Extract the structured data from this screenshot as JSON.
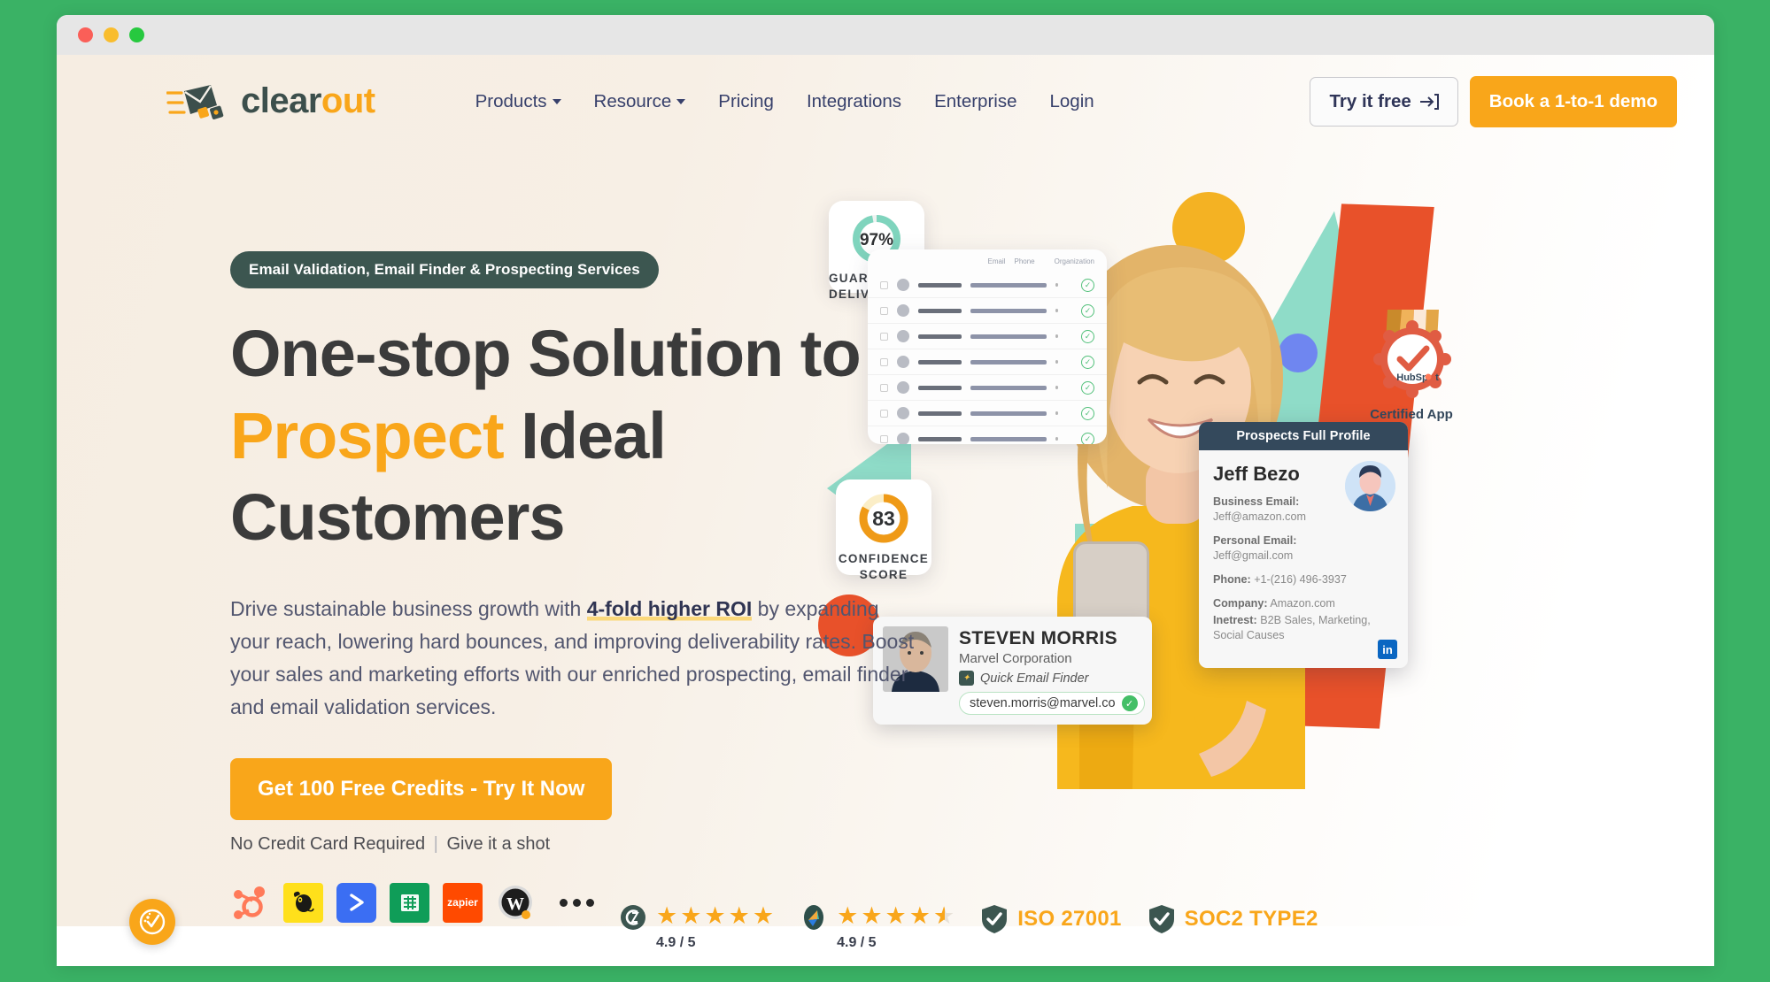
{
  "browser": {
    "dots": [
      "close",
      "minimize",
      "maximize"
    ]
  },
  "header": {
    "logo": {
      "part1": "clear",
      "part2": "out",
      "icon": "envelope-speed-icon"
    },
    "nav": [
      {
        "label": "Products",
        "has_caret": true
      },
      {
        "label": "Resource",
        "has_caret": true
      },
      {
        "label": "Pricing",
        "has_caret": false
      },
      {
        "label": "Integrations",
        "has_caret": false
      },
      {
        "label": "Enterprise",
        "has_caret": false
      },
      {
        "label": "Login",
        "has_caret": false
      }
    ],
    "try_free_label": "Try it free",
    "try_free_icon": "login-arrow-icon",
    "demo_label": "Book a 1-to-1 demo"
  },
  "hero": {
    "eyebrow": "Email Validation, Email Finder & Prospecting Services",
    "headline_part1": "One-stop Solution to ",
    "headline_highlight": "Prospect",
    "headline_part2": " Ideal Customers",
    "paragraph_part1": "Drive sustainable business growth with ",
    "paragraph_highlight": "4-fold higher ROI",
    "paragraph_part2": " by expanding your reach, lowering hard bounces, and improving deliverability rates. Boost your sales and marketing efforts with our enriched prospecting, email finder and email validation services.",
    "cta_label": "Get 100 Free Credits - Try It Now",
    "cta_note_left": "No Credit Card Required",
    "cta_note_sep": "|",
    "cta_note_right": "Give it a shot",
    "integrations": [
      {
        "name": "hubspot-icon",
        "label": ""
      },
      {
        "name": "mailchimp-icon",
        "label": ""
      },
      {
        "name": "sendinblue-icon",
        "label": ""
      },
      {
        "name": "google-sheets-icon",
        "label": ""
      },
      {
        "name": "zapier-icon",
        "label": "zapier"
      },
      {
        "name": "wordpress-icon",
        "label": ""
      },
      {
        "name": "more-integrations-icon",
        "label": ""
      }
    ]
  },
  "trustbar": [
    {
      "type": "rating",
      "icon": "g2-icon",
      "stars": 5,
      "half": false,
      "rating": "4.9 / 5"
    },
    {
      "type": "rating",
      "icon": "capterra-icon",
      "stars": 4,
      "half": true,
      "rating": "4.9 / 5"
    },
    {
      "type": "cert",
      "icon": "shield-check-icon",
      "label": "ISO 27001"
    },
    {
      "type": "cert",
      "icon": "shield-check-icon",
      "label": "SOC2 TYPE2"
    }
  ],
  "art": {
    "deliverables_card": {
      "value": "97%",
      "label_line1": "GUARANTEED",
      "label_line2": "DELIVERABLES",
      "ring_color": "#7fd4bd",
      "percent": 97
    },
    "confidence_card": {
      "value": "83",
      "label_line1": "CONFIDENCE",
      "label_line2": "SCORE",
      "ring_color": "#ef9a17",
      "percent": 83
    },
    "table_card": {
      "headers": [
        "Email",
        "Phone",
        "Organization"
      ],
      "rows": 10
    },
    "steven_card": {
      "name": "STEVEN MORRIS",
      "company": "Marvel Corporation",
      "feature": "Quick Email Finder",
      "email": "steven.morris@marvel.co",
      "verified_icon": "green-check-icon"
    },
    "profile_card": {
      "title": "Prospects Full Profile",
      "name": "Jeff Bezo",
      "fields": [
        {
          "label": "Business Email:",
          "value": "Jeff@amazon.com",
          "inline": false
        },
        {
          "label": "Personal Email:",
          "value": "Jeff@gmail.com",
          "inline": false
        },
        {
          "label": "Phone:",
          "value": "+1-(216) 496-3937",
          "inline": true
        },
        {
          "label": "Company:",
          "value": "Amazon.com",
          "inline": true
        },
        {
          "label": "Inetrest:",
          "value": "B2B Sales, Marketing, Social Causes",
          "inline": true
        }
      ],
      "social_icon": "linkedin-icon",
      "social_label": "in"
    },
    "hubspot_badge": {
      "icon": "hubspot-medal-icon",
      "caption": "Certified App"
    },
    "shapes": {
      "teal": "#8fdcc8",
      "orange_slab": "#e8512a",
      "yellow_circle": "#f4b223",
      "blue_circle": "#6f86f0",
      "navy_chip": "#1e3a5f"
    }
  },
  "widget": {
    "icon": "accessibility-check-icon"
  },
  "colors": {
    "brand_orange": "#f9a61a",
    "dark_slate": "#3c5650",
    "page_green": "#3ab265",
    "hero_cream": "#f6ede2",
    "nav_text": "#37406b"
  }
}
